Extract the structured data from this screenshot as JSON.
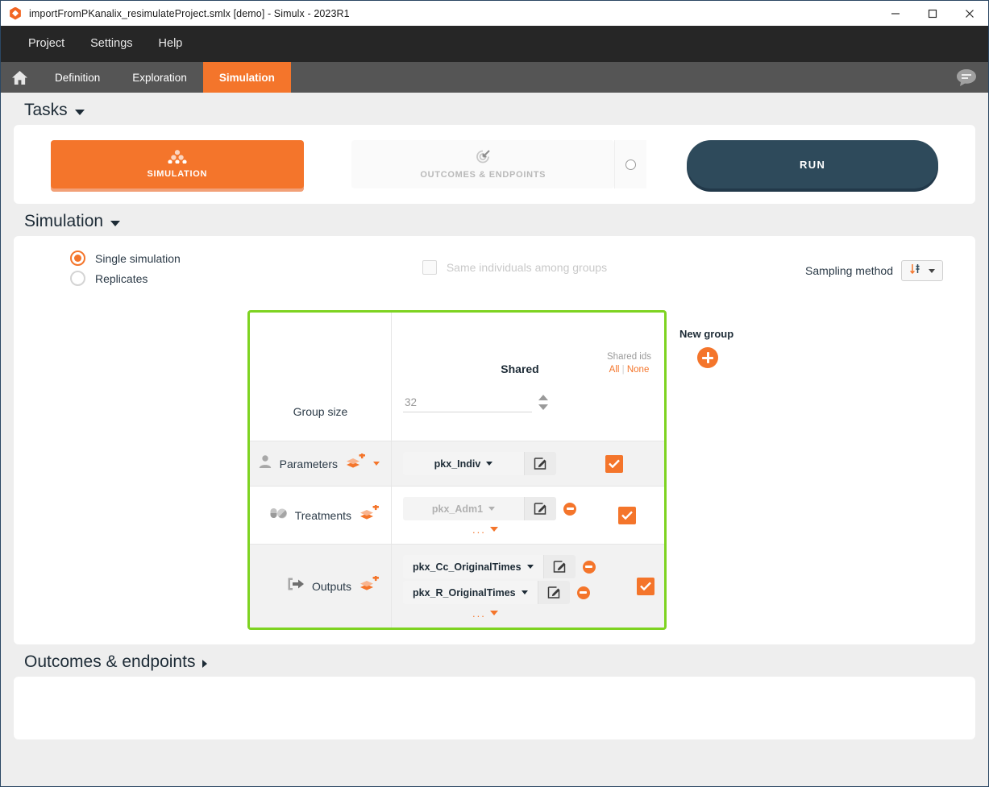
{
  "window": {
    "title": "importFromPKanalix_resimulateProject.smlx [demo]  - Simulx - 2023R1",
    "app_icon": "simulx-hex-icon",
    "minimize_label": "Minimize",
    "maximize_label": "Maximize",
    "close_label": "Close"
  },
  "menubar": {
    "items": [
      {
        "label": "Project"
      },
      {
        "label": "Settings"
      },
      {
        "label": "Help"
      }
    ]
  },
  "tabbar": {
    "home_icon": "home-icon",
    "chat_icon": "chat-bubble-icon",
    "tabs": [
      {
        "label": "Definition",
        "active": false
      },
      {
        "label": "Exploration",
        "active": false
      },
      {
        "label": "Simulation",
        "active": true
      }
    ]
  },
  "tasks": {
    "title": "Tasks",
    "simulation_task": {
      "label": "SIMULATION",
      "icon": "group-dots-icon",
      "selected": true
    },
    "outcomes_task": {
      "label": "OUTCOMES & ENDPOINTS",
      "icon": "target-arrow-icon",
      "selected": false
    },
    "run_label": "RUN"
  },
  "simulation": {
    "title": "Simulation",
    "mode_options": [
      {
        "label": "Single simulation",
        "selected": true
      },
      {
        "label": "Replicates",
        "selected": false
      }
    ],
    "same_individuals": {
      "label": "Same individuals among groups",
      "checked": false,
      "disabled": true
    },
    "sampling": {
      "label": "Sampling method",
      "icon": "sort-sliders-icon"
    },
    "table": {
      "group_size_label": "Group size",
      "group_size_value": "32",
      "shared_header": "Shared",
      "shared_ids_label": "Shared ids",
      "shared_ids_all": "All",
      "shared_ids_sep": "|",
      "shared_ids_none": "None",
      "rows": [
        {
          "label": "Parameters",
          "icon": "person-icon",
          "add_icon": "add-layers-icon",
          "has_add_caret": true,
          "chips": [
            {
              "name": "pkx_Indiv",
              "muted": false,
              "removable": false,
              "edit_icon": "pencil-edit-icon"
            }
          ],
          "show_more": false,
          "checked": true
        },
        {
          "label": "Treatments",
          "icon": "pills-icon",
          "add_icon": "add-layers-icon",
          "has_add_caret": false,
          "chips": [
            {
              "name": "pkx_Adm1",
              "muted": true,
              "removable": true,
              "edit_icon": "pencil-edit-icon"
            }
          ],
          "show_more": true,
          "more_label": "...",
          "checked": true
        },
        {
          "label": "Outputs",
          "icon": "export-arrow-icon",
          "add_icon": "add-layers-icon",
          "has_add_caret": false,
          "chips": [
            {
              "name": "pkx_Cc_OriginalTimes",
              "muted": false,
              "removable": true,
              "edit_icon": "pencil-edit-icon"
            },
            {
              "name": "pkx_R_OriginalTimes",
              "muted": false,
              "removable": true,
              "edit_icon": "pencil-edit-icon"
            }
          ],
          "show_more": true,
          "more_label": "...",
          "checked": true
        }
      ]
    },
    "new_group": {
      "label": "New group",
      "icon": "plus-circle-icon"
    }
  },
  "outcomes_section": {
    "title": "Outcomes & endpoints"
  },
  "colors": {
    "accent_orange": "#f4752b",
    "run_dark": "#2e4a5b",
    "group_border_green": "#7ed321",
    "menubar_dark": "#262626",
    "tabbar_grey": "#555555",
    "page_bg": "#eeeeee"
  }
}
